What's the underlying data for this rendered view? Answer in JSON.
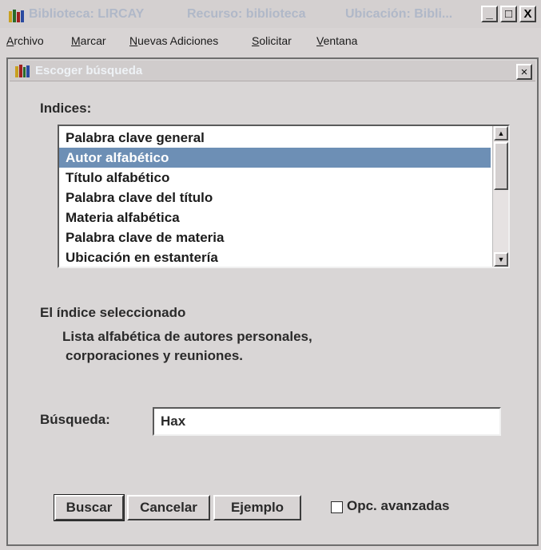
{
  "window": {
    "title_app": "Biblioteca: LIRCAY",
    "title_resource": "Recurso: biblioteca",
    "title_location": "Ubicación: Bibli...",
    "minimize_glyph": "_",
    "maximize_glyph": "□",
    "close_glyph": "X"
  },
  "menu": {
    "items": [
      {
        "first": "A",
        "rest": "rchivo"
      },
      {
        "first": "M",
        "rest": "arcar"
      },
      {
        "first": "N",
        "rest": "uevas Adiciones"
      },
      {
        "first": "S",
        "rest": "olicitar"
      },
      {
        "first": "V",
        "rest": "entana"
      }
    ]
  },
  "dialog": {
    "title": "Escoger búsqueda",
    "close_glyph": "×",
    "indices_label": "Indices:",
    "indices": [
      "Palabra clave general",
      "Autor alfabético",
      "Título alfabético",
      "Palabra clave del título",
      "Materia alfabética",
      "Palabra clave de materia",
      "Ubicación en estantería"
    ],
    "selected_index": 1,
    "selected_label": "El índice seleccionado",
    "description_line1": "Lista alfabética de autores personales,",
    "description_line2": "corporaciones y reuniones.",
    "search_label": "Búsqueda:",
    "search_value": "Hax",
    "buttons": {
      "search": "Buscar",
      "cancel": "Cancelar",
      "example": "Ejemplo"
    },
    "advanced_label": "Opc. avanzadas",
    "advanced_checked": false
  },
  "colors": {
    "selection": "#6d8fb5",
    "titlebar_text": "#b0b8c8"
  }
}
